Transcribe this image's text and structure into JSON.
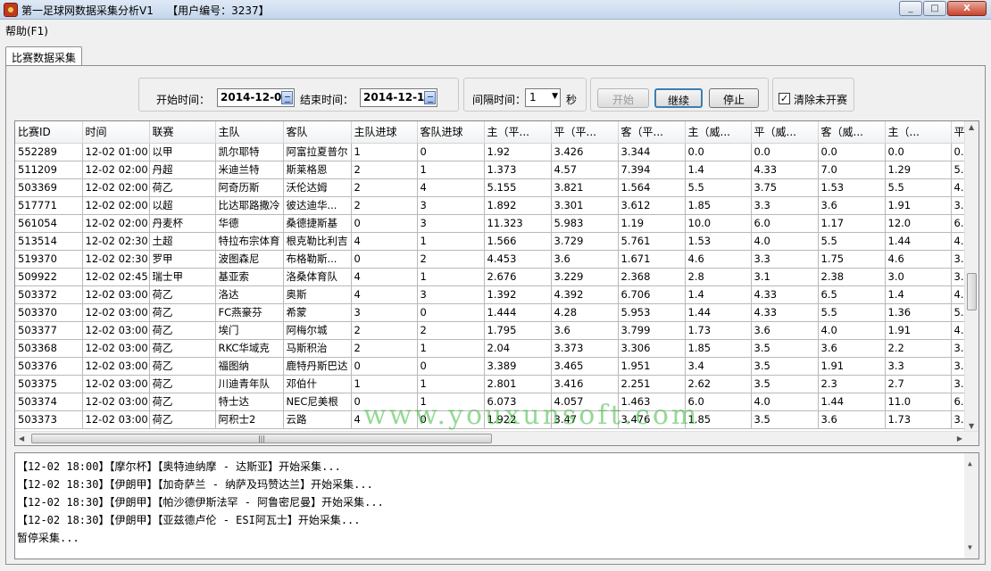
{
  "window": {
    "title": "第一足球网数据采集分析V1    【用户编号：3237】",
    "min": "_",
    "max": "□",
    "close": "X"
  },
  "menu": {
    "help": "帮助(F1)"
  },
  "tab": {
    "label": "比赛数据采集"
  },
  "controls": {
    "start_label": "开始时间：",
    "start_value": "2014-12-01",
    "end_label": "结束时间：",
    "end_value": "2014-12-15",
    "interval_label": "间隔时间：",
    "interval_value": "1",
    "interval_unit": "秒",
    "start_button": "开始",
    "continue_button": "继续",
    "stop_button": "停止",
    "clear_label": "清除未开赛",
    "clear_checked": "✓"
  },
  "table": {
    "columns": [
      "比赛ID",
      "时间",
      "联赛",
      "主队",
      "客队",
      "主队进球",
      "客队进球",
      "主（平...",
      "平（平...",
      "客（平...",
      "主（威...",
      "平（威...",
      "客（威...",
      "主（...",
      "平"
    ],
    "rows": [
      [
        "552289",
        "12-02 01:00",
        "以甲",
        "凯尔耶特",
        "阿富拉夏普尔",
        "1",
        "0",
        "1.92",
        "3.426",
        "3.344",
        "0.0",
        "0.0",
        "0.0",
        "0.0",
        "0."
      ],
      [
        "511209",
        "12-02 02:00",
        "丹超",
        "米迪兰特",
        "斯莱格恩",
        "2",
        "1",
        "1.373",
        "4.57",
        "7.394",
        "1.4",
        "4.33",
        "7.0",
        "1.29",
        "5."
      ],
      [
        "503369",
        "12-02 02:00",
        "荷乙",
        "阿奇历斯",
        "沃伦达姆",
        "2",
        "4",
        "5.155",
        "3.821",
        "1.564",
        "5.5",
        "3.75",
        "1.53",
        "5.5",
        "4."
      ],
      [
        "517771",
        "12-02 02:00",
        "以超",
        "比达耶路撒冷",
        "彼达迪华...",
        "2",
        "3",
        "1.892",
        "3.301",
        "3.612",
        "1.85",
        "3.3",
        "3.6",
        "1.91",
        "3."
      ],
      [
        "561054",
        "12-02 02:00",
        "丹麦杯",
        "华德",
        "桑德捷斯基",
        "0",
        "3",
        "11.323",
        "5.983",
        "1.19",
        "10.0",
        "6.0",
        "1.17",
        "12.0",
        "6."
      ],
      [
        "513514",
        "12-02 02:30",
        "土超",
        "特拉布宗体育",
        "根克勒比利吉",
        "4",
        "1",
        "1.566",
        "3.729",
        "5.761",
        "1.53",
        "4.0",
        "5.5",
        "1.44",
        "4."
      ],
      [
        "519370",
        "12-02 02:30",
        "罗甲",
        "波图森尼",
        "布格勒斯...",
        "0",
        "2",
        "4.453",
        "3.6",
        "1.671",
        "4.6",
        "3.3",
        "1.75",
        "4.6",
        "3."
      ],
      [
        "509922",
        "12-02 02:45",
        "瑞士甲",
        "基亚索",
        "洛桑体育队",
        "4",
        "1",
        "2.676",
        "3.229",
        "2.368",
        "2.8",
        "3.1",
        "2.38",
        "3.0",
        "3."
      ],
      [
        "503372",
        "12-02 03:00",
        "荷乙",
        "洛达",
        "奥斯",
        "4",
        "3",
        "1.392",
        "4.392",
        "6.706",
        "1.4",
        "4.33",
        "6.5",
        "1.4",
        "4."
      ],
      [
        "503370",
        "12-02 03:00",
        "荷乙",
        "FC燕豪芬",
        "希蒙",
        "3",
        "0",
        "1.444",
        "4.28",
        "5.953",
        "1.44",
        "4.33",
        "5.5",
        "1.36",
        "5."
      ],
      [
        "503377",
        "12-02 03:00",
        "荷乙",
        "埃门",
        "阿梅尔城",
        "2",
        "2",
        "1.795",
        "3.6",
        "3.799",
        "1.73",
        "3.6",
        "4.0",
        "1.91",
        "4."
      ],
      [
        "503368",
        "12-02 03:00",
        "荷乙",
        "RKC华域克",
        "马斯积治",
        "2",
        "1",
        "2.04",
        "3.373",
        "3.306",
        "1.85",
        "3.5",
        "3.6",
        "2.2",
        "3."
      ],
      [
        "503376",
        "12-02 03:00",
        "荷乙",
        "福图纳",
        "鹿特丹斯巴达",
        "0",
        "0",
        "3.389",
        "3.465",
        "1.951",
        "3.4",
        "3.5",
        "1.91",
        "3.3",
        "3."
      ],
      [
        "503375",
        "12-02 03:00",
        "荷乙",
        "川迪青年队",
        "邓伯什",
        "1",
        "1",
        "2.801",
        "3.416",
        "2.251",
        "2.62",
        "3.5",
        "2.3",
        "2.7",
        "3."
      ],
      [
        "503374",
        "12-02 03:00",
        "荷乙",
        "特士达",
        "NEC尼美根",
        "0",
        "1",
        "6.073",
        "4.057",
        "1.463",
        "6.0",
        "4.0",
        "1.44",
        "11.0",
        "6."
      ],
      [
        "503373",
        "12-02 03:00",
        "荷乙",
        "阿积士2",
        "云路",
        "4",
        "0",
        "1.922",
        "3.47",
        "3.476",
        "1.85",
        "3.5",
        "3.6",
        "1.73",
        "3."
      ]
    ]
  },
  "watermark": "www.youxunsoft.com",
  "log": [
    "【12-02 18:00】【摩尔杯】【奥特迪纳摩 - 达斯亚】开始采集...",
    "【12-02 18:30】【伊朗甲】【加奇萨兰 - 纳萨及玛赞达兰】开始采集...",
    "【12-02 18:30】【伊朗甲】【帕沙德伊斯法罕 - 阿鲁密尼曼】开始采集...",
    "【12-02 18:30】【伊朗甲】【亚兹德卢伦 - ESI阿瓦士】开始采集...",
    "暂停采集..."
  ]
}
